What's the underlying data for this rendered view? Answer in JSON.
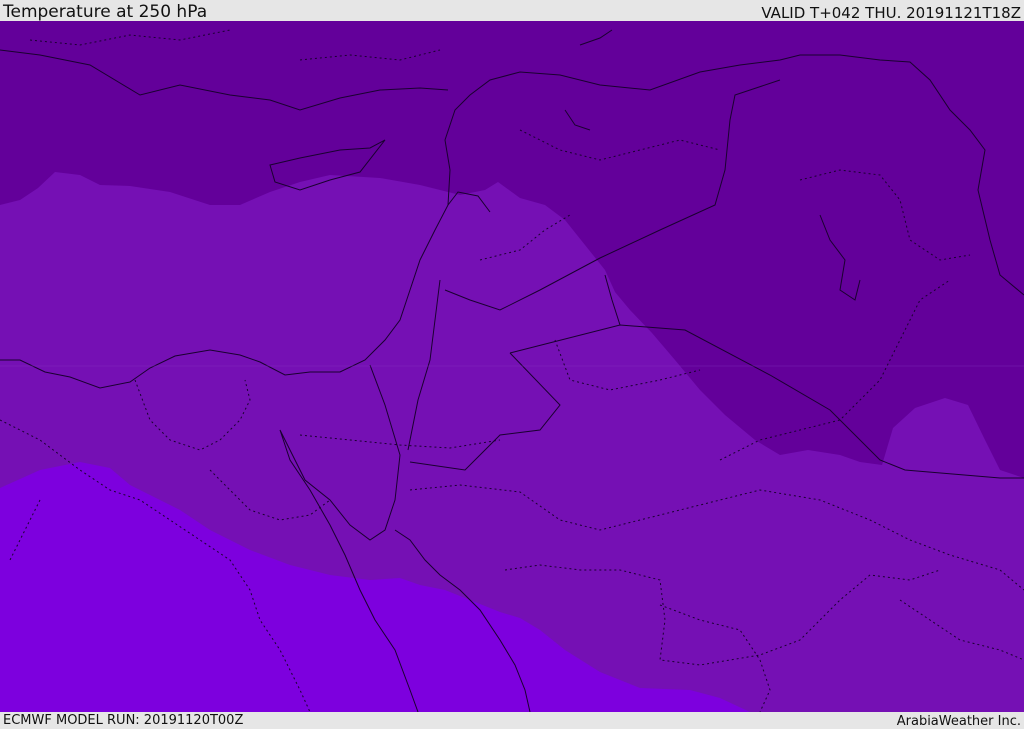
{
  "header": {
    "title": "Temperature at 250 hPa",
    "valid": "VALID T+042 THU. 20191121T18Z"
  },
  "footer": {
    "model_run": "ECMWF MODEL RUN: 20191120T00Z",
    "credit": "ArabiaWeather Inc."
  },
  "map": {
    "colors": {
      "band_cold": "#63009a",
      "band_mid": "#7510b4",
      "band_warm": "#7d00de",
      "border": "#1a0030",
      "sea": "#7510b4"
    }
  }
}
